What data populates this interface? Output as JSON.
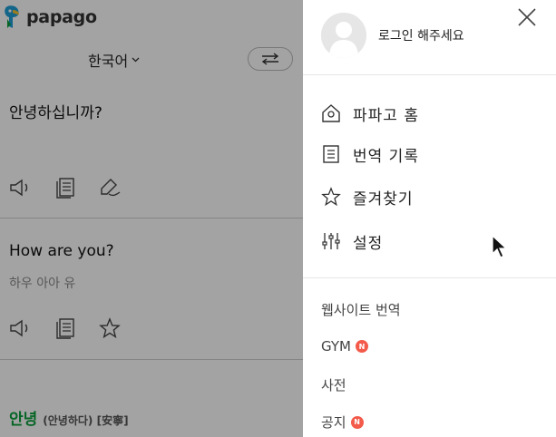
{
  "header": {
    "logo_text": "papago"
  },
  "translator": {
    "source_language": "한국어",
    "source_text": "안녕하십니까?",
    "target_text": "How are you?",
    "pronunciation": "하우 아아 유"
  },
  "dictionary": {
    "word": "안녕",
    "detail": "(안녕하다) [安寧]"
  },
  "panel": {
    "login_text": "로그인 해주세요",
    "menu": [
      {
        "label": "파파고 홈",
        "icon": "home-icon"
      },
      {
        "label": "번역 기록",
        "icon": "history-icon"
      },
      {
        "label": "즐겨찾기",
        "icon": "star-icon"
      },
      {
        "label": "설정",
        "icon": "settings-sliders-icon"
      }
    ],
    "links": [
      {
        "label": "웹사이트 번역",
        "badge": ""
      },
      {
        "label": "GYM",
        "badge": "N"
      },
      {
        "label": "사전",
        "badge": ""
      },
      {
        "label": "공지",
        "badge": "N"
      }
    ]
  },
  "colors": {
    "dim_overlay": "rgba(0,0,0,0.36)",
    "dictionary_green": "#0a9e3b",
    "new_badge": "#f35a4a"
  }
}
